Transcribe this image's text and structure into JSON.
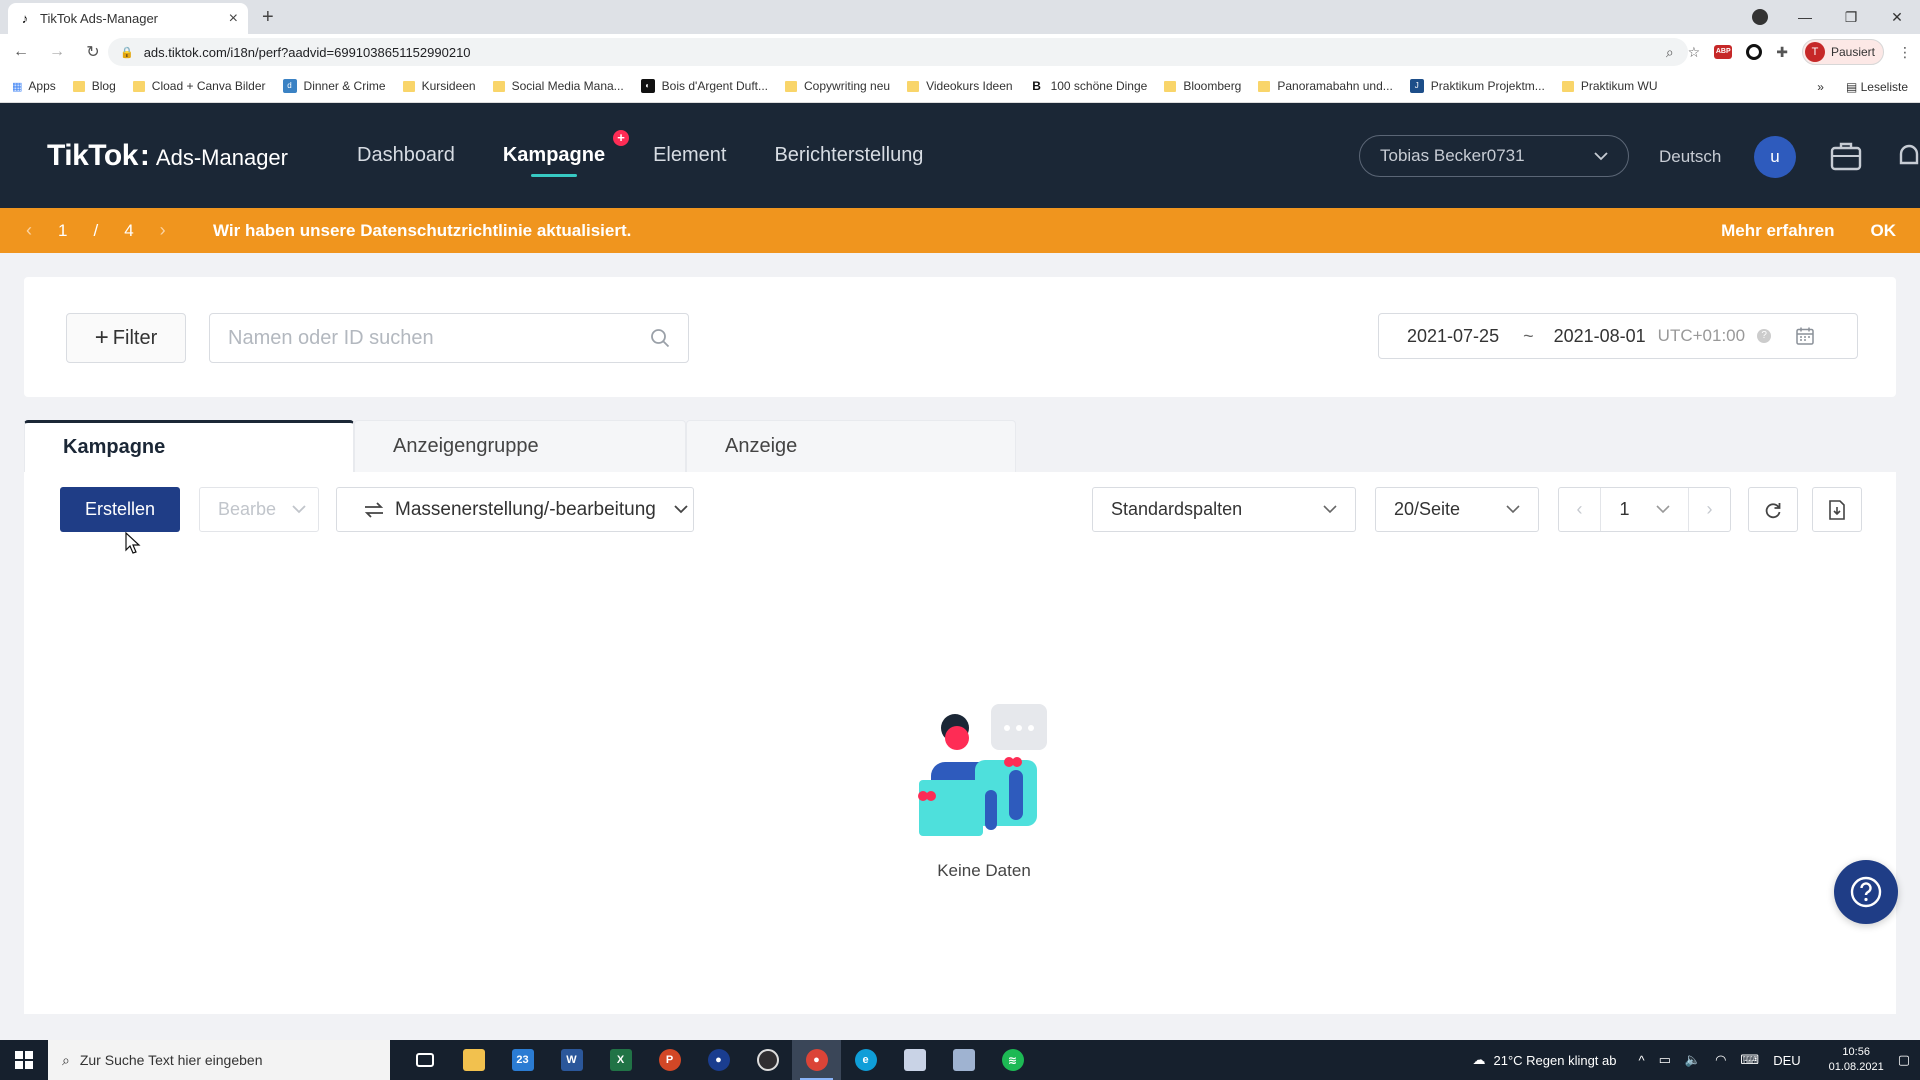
{
  "browser": {
    "tab_title": "TikTok Ads-Manager",
    "url": "ads.tiktok.com/i18n/perf?aadvid=6991038651152990210",
    "profile_label": "Pausiert",
    "profile_initial": "T",
    "bookmarks": [
      "Apps",
      "Blog",
      "Cload + Canva Bilder",
      "Dinner & Crime",
      "Kursideen",
      "Social Media Mana...",
      "Bois d'Argent Duft...",
      "Copywriting neu",
      "Videokurs Ideen",
      "100 schöne Dinge",
      "Bloomberg",
      "Panoramabahn und...",
      "Praktikum Projektm...",
      "Praktikum WU"
    ],
    "reading_list": "Leseliste"
  },
  "header": {
    "brand": "TikTok",
    "product": "Ads-Manager",
    "nav": [
      "Dashboard",
      "Kampagne",
      "Element",
      "Berichterstellung"
    ],
    "active_nav": "Kampagne",
    "badge": "+",
    "account": "Tobias Becker0731",
    "language": "Deutsch",
    "user_initial": "u"
  },
  "notice": {
    "current": "1",
    "separator": "/",
    "total": "4",
    "message": "Wir haben unsere Datenschutzrichtlinie aktualisiert.",
    "learn_more": "Mehr erfahren",
    "ok": "OK"
  },
  "filters": {
    "filter_label": "Filter",
    "search_placeholder": "Namen oder ID suchen",
    "date_start": "2021-07-25",
    "date_sep": "~",
    "date_end": "2021-08-01",
    "timezone": "UTC+01:00"
  },
  "tabs": [
    "Kampagne",
    "Anzeigengruppe",
    "Anzeige"
  ],
  "toolbar": {
    "create": "Erstellen",
    "edit": "Bearbe",
    "mass": "Massenerstellung/-bearbeitung",
    "columns": "Standardspalten",
    "per_page": "20/Seite",
    "page": "1"
  },
  "empty_state": "Keine Daten",
  "taskbar": {
    "search_placeholder": "Zur Suche Text hier eingeben",
    "mail_count": "23",
    "weather": "21°C  Regen klingt ab",
    "lang": "DEU",
    "time": "10:56",
    "date": "01.08.2021"
  },
  "colors": {
    "header_bg": "#1b2736",
    "notice_bg": "#f0951e",
    "primary": "#1f3d86",
    "active_underline": "#37c9c3"
  }
}
